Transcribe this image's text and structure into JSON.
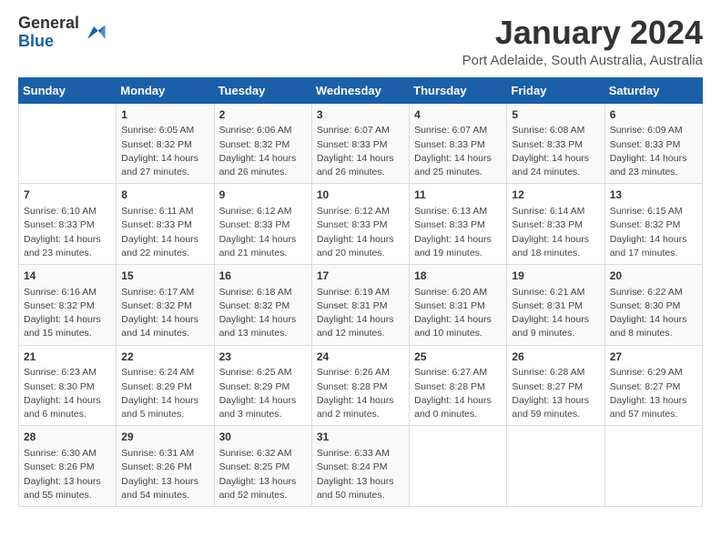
{
  "header": {
    "logo_general": "General",
    "logo_blue": "Blue",
    "title": "January 2024",
    "subtitle": "Port Adelaide, South Australia, Australia"
  },
  "calendar": {
    "days_of_week": [
      "Sunday",
      "Monday",
      "Tuesday",
      "Wednesday",
      "Thursday",
      "Friday",
      "Saturday"
    ],
    "weeks": [
      [
        {
          "num": "",
          "info": ""
        },
        {
          "num": "1",
          "info": "Sunrise: 6:05 AM\nSunset: 8:32 PM\nDaylight: 14 hours\nand 27 minutes."
        },
        {
          "num": "2",
          "info": "Sunrise: 6:06 AM\nSunset: 8:32 PM\nDaylight: 14 hours\nand 26 minutes."
        },
        {
          "num": "3",
          "info": "Sunrise: 6:07 AM\nSunset: 8:33 PM\nDaylight: 14 hours\nand 26 minutes."
        },
        {
          "num": "4",
          "info": "Sunrise: 6:07 AM\nSunset: 8:33 PM\nDaylight: 14 hours\nand 25 minutes."
        },
        {
          "num": "5",
          "info": "Sunrise: 6:08 AM\nSunset: 8:33 PM\nDaylight: 14 hours\nand 24 minutes."
        },
        {
          "num": "6",
          "info": "Sunrise: 6:09 AM\nSunset: 8:33 PM\nDaylight: 14 hours\nand 23 minutes."
        }
      ],
      [
        {
          "num": "7",
          "info": "Sunrise: 6:10 AM\nSunset: 8:33 PM\nDaylight: 14 hours\nand 23 minutes."
        },
        {
          "num": "8",
          "info": "Sunrise: 6:11 AM\nSunset: 8:33 PM\nDaylight: 14 hours\nand 22 minutes."
        },
        {
          "num": "9",
          "info": "Sunrise: 6:12 AM\nSunset: 8:33 PM\nDaylight: 14 hours\nand 21 minutes."
        },
        {
          "num": "10",
          "info": "Sunrise: 6:12 AM\nSunset: 8:33 PM\nDaylight: 14 hours\nand 20 minutes."
        },
        {
          "num": "11",
          "info": "Sunrise: 6:13 AM\nSunset: 8:33 PM\nDaylight: 14 hours\nand 19 minutes."
        },
        {
          "num": "12",
          "info": "Sunrise: 6:14 AM\nSunset: 8:33 PM\nDaylight: 14 hours\nand 18 minutes."
        },
        {
          "num": "13",
          "info": "Sunrise: 6:15 AM\nSunset: 8:32 PM\nDaylight: 14 hours\nand 17 minutes."
        }
      ],
      [
        {
          "num": "14",
          "info": "Sunrise: 6:16 AM\nSunset: 8:32 PM\nDaylight: 14 hours\nand 15 minutes."
        },
        {
          "num": "15",
          "info": "Sunrise: 6:17 AM\nSunset: 8:32 PM\nDaylight: 14 hours\nand 14 minutes."
        },
        {
          "num": "16",
          "info": "Sunrise: 6:18 AM\nSunset: 8:32 PM\nDaylight: 14 hours\nand 13 minutes."
        },
        {
          "num": "17",
          "info": "Sunrise: 6:19 AM\nSunset: 8:31 PM\nDaylight: 14 hours\nand 12 minutes."
        },
        {
          "num": "18",
          "info": "Sunrise: 6:20 AM\nSunset: 8:31 PM\nDaylight: 14 hours\nand 10 minutes."
        },
        {
          "num": "19",
          "info": "Sunrise: 6:21 AM\nSunset: 8:31 PM\nDaylight: 14 hours\nand 9 minutes."
        },
        {
          "num": "20",
          "info": "Sunrise: 6:22 AM\nSunset: 8:30 PM\nDaylight: 14 hours\nand 8 minutes."
        }
      ],
      [
        {
          "num": "21",
          "info": "Sunrise: 6:23 AM\nSunset: 8:30 PM\nDaylight: 14 hours\nand 6 minutes."
        },
        {
          "num": "22",
          "info": "Sunrise: 6:24 AM\nSunset: 8:29 PM\nDaylight: 14 hours\nand 5 minutes."
        },
        {
          "num": "23",
          "info": "Sunrise: 6:25 AM\nSunset: 8:29 PM\nDaylight: 14 hours\nand 3 minutes."
        },
        {
          "num": "24",
          "info": "Sunrise: 6:26 AM\nSunset: 8:28 PM\nDaylight: 14 hours\nand 2 minutes."
        },
        {
          "num": "25",
          "info": "Sunrise: 6:27 AM\nSunset: 8:28 PM\nDaylight: 14 hours\nand 0 minutes."
        },
        {
          "num": "26",
          "info": "Sunrise: 6:28 AM\nSunset: 8:27 PM\nDaylight: 13 hours\nand 59 minutes."
        },
        {
          "num": "27",
          "info": "Sunrise: 6:29 AM\nSunset: 8:27 PM\nDaylight: 13 hours\nand 57 minutes."
        }
      ],
      [
        {
          "num": "28",
          "info": "Sunrise: 6:30 AM\nSunset: 8:26 PM\nDaylight: 13 hours\nand 55 minutes."
        },
        {
          "num": "29",
          "info": "Sunrise: 6:31 AM\nSunset: 8:26 PM\nDaylight: 13 hours\nand 54 minutes."
        },
        {
          "num": "30",
          "info": "Sunrise: 6:32 AM\nSunset: 8:25 PM\nDaylight: 13 hours\nand 52 minutes."
        },
        {
          "num": "31",
          "info": "Sunrise: 6:33 AM\nSunset: 8:24 PM\nDaylight: 13 hours\nand 50 minutes."
        },
        {
          "num": "",
          "info": ""
        },
        {
          "num": "",
          "info": ""
        },
        {
          "num": "",
          "info": ""
        }
      ]
    ]
  }
}
